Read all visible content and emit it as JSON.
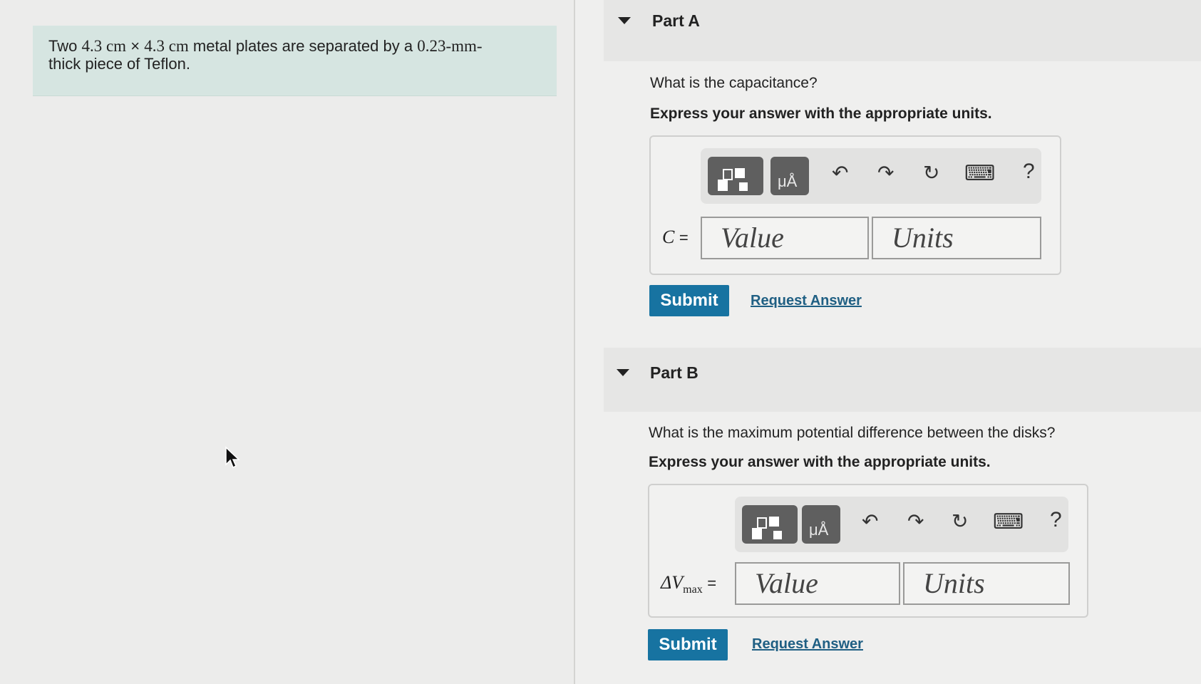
{
  "problem": {
    "text_before": "Two ",
    "dim1": "4.3 cm",
    "times": "×",
    "dim2": "4.3 cm",
    "text_middle": " metal plates are separated by a ",
    "thickness": "0.23-mm-",
    "text_after": "thick piece of Teflon."
  },
  "partA": {
    "title": "Part A",
    "question": "What is the capacitance?",
    "instruction": "Express your answer with the appropriate units.",
    "variable": "C",
    "equals": "=",
    "value_placeholder": "Value",
    "units_placeholder": "Units",
    "submit_label": "Submit",
    "request_label": "Request Answer"
  },
  "partB": {
    "title": "Part B",
    "question": "What is the maximum potential difference between the disks?",
    "instruction": "Express your answer with the appropriate units.",
    "variable_prefix": "ΔV",
    "variable_sub": "max",
    "equals": "=",
    "value_placeholder": "Value",
    "units_placeholder": "Units",
    "submit_label": "Submit",
    "request_label": "Request Answer"
  },
  "toolbar": {
    "units_glyph": "μÅ",
    "undo_glyph": "↶",
    "redo_glyph": "↷",
    "reset_glyph": "↻",
    "keyboard_glyph": "⌨",
    "help_glyph": "?"
  },
  "icons": [
    "templates-icon",
    "units-icon",
    "undo-icon",
    "redo-icon",
    "reset-icon",
    "keyboard-icon",
    "help-icon",
    "collapse-caret-icon",
    "mouse-cursor-icon"
  ],
  "colors": {
    "submit": "#1773a1",
    "link": "#1f5f83",
    "problem_bg": "#d6e5e1"
  }
}
